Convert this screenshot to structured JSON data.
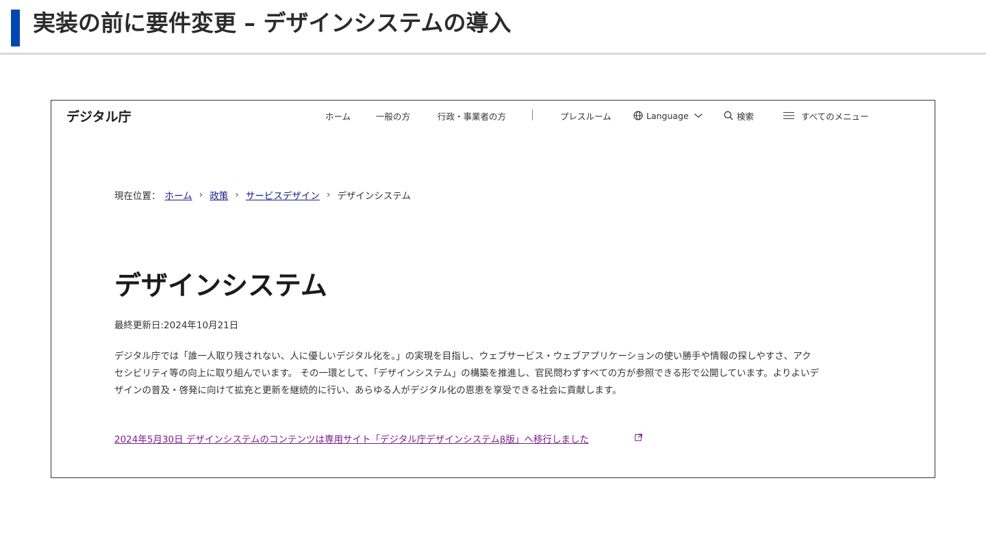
{
  "slide": {
    "title": "実装の前に要件変更 – デザインシステムの導入"
  },
  "site": {
    "logo": "デジタル庁",
    "nav": {
      "home": "ホーム",
      "general": "一般の方",
      "business": "行政・事業者の方",
      "press": "プレスルーム",
      "language": "Language",
      "search": "検索",
      "menu": "すべてのメニュー"
    }
  },
  "breadcrumb": {
    "prefix": "現在位置：",
    "items": [
      "ホーム",
      "政策",
      "サービスデザイン"
    ],
    "current": "デザインシステム"
  },
  "page": {
    "title": "デザインシステム",
    "updated": "最終更新日:2024年10月21日",
    "body": "デジタル庁では「誰一人取り残されない、人に優しいデジタル化を。」の実現を目指し、ウェブサービス・ウェブアプリケーションの使い勝手や情報の探しやすさ、アクセシビリティ等の向上に取り組んでいます。 その一環として、「デザインシステム」の構築を推進し、官民問わずすべての方が参照できる形で公開しています。よりよいデザインの普及・啓発に向けて拡充と更新を継続的に行い、あらゆる人がデジタル化の恩恵を享受できる社会に貢献します。",
    "notice_link": "2024年5月30日 デザインシステムのコンテンツは専用サイト「デジタル庁デザインシステムβ版」へ移行しました"
  },
  "colors": {
    "accent": "#0047b3",
    "link": "#1a1a8c",
    "visited_link": "#7b1e8c"
  },
  "icons": [
    "globe-icon",
    "chevron-down-icon",
    "search-icon",
    "hamburger-menu-icon",
    "external-link-icon"
  ]
}
